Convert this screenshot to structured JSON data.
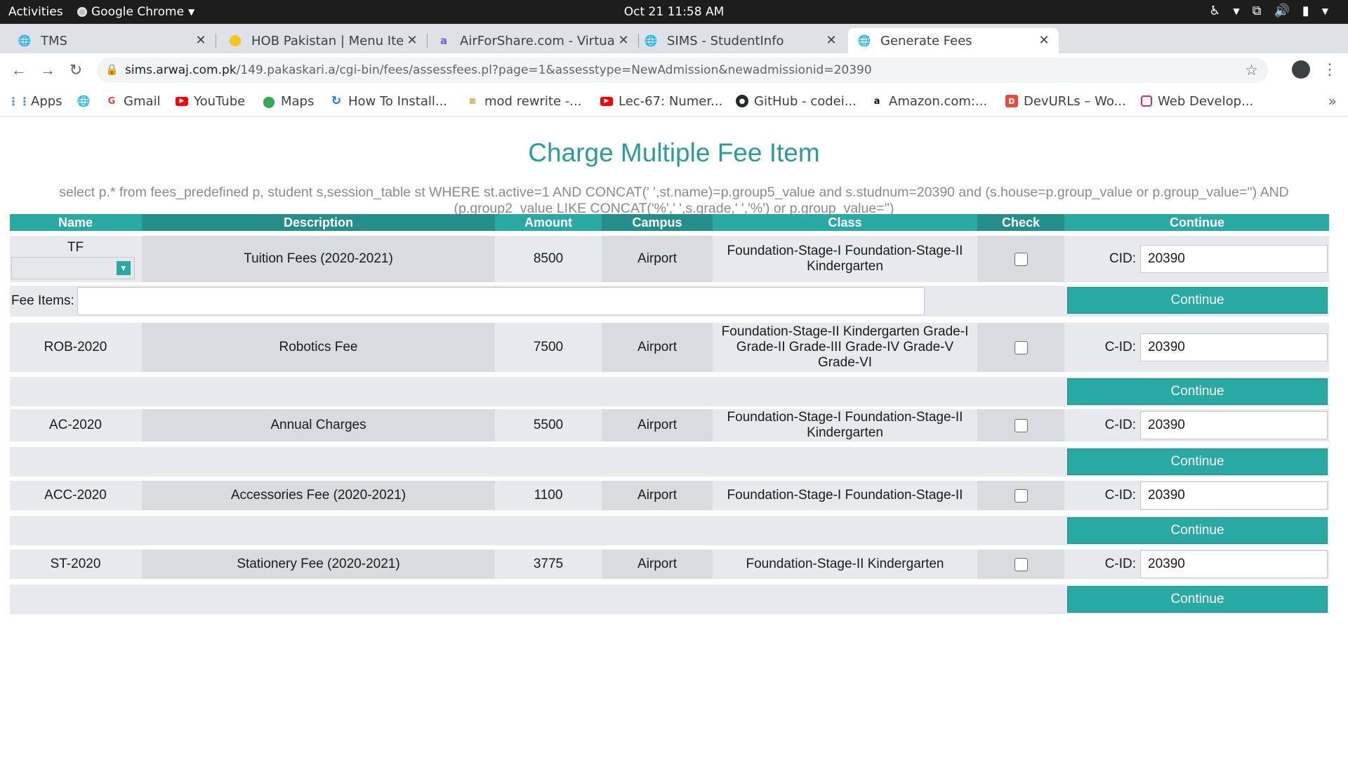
{
  "system": {
    "activities": "Activities",
    "app_name": "Google Chrome",
    "clock": "Oct 21  11:58 AM"
  },
  "tabs": [
    {
      "title": "TMS",
      "icon": "globe-icon",
      "active": false
    },
    {
      "title": "HOB Pakistan | Menu Item",
      "icon": "burger-icon",
      "active": false
    },
    {
      "title": "AirForShare.com - Virtual",
      "icon": "airforshare-icon",
      "active": false
    },
    {
      "title": "SIMS - StudentInfo",
      "icon": "globe-icon",
      "active": false
    },
    {
      "title": "Generate Fees",
      "icon": "globe-icon",
      "active": true
    }
  ],
  "address": {
    "host": "sims.arwaj.com.pk",
    "path": "/149.pakaskari.a/cgi-bin/fees/assessfees.pl?page=1&assesstype=NewAdmission&newadmissionid=20390"
  },
  "bookmarks": [
    {
      "label": "Apps",
      "icon": "apps-grid-icon"
    },
    {
      "label": "",
      "icon": "globe-icon"
    },
    {
      "label": "Gmail",
      "icon": "google-icon"
    },
    {
      "label": "YouTube",
      "icon": "youtube-icon"
    },
    {
      "label": "Maps",
      "icon": "maps-pin-icon"
    },
    {
      "label": "How To Install...",
      "icon": "refresh-blue-icon"
    },
    {
      "label": "mod rewrite -...",
      "icon": "stackoverflow-icon"
    },
    {
      "label": "Lec-67: Numer...",
      "icon": "youtube-icon"
    },
    {
      "label": "GitHub - codei...",
      "icon": "github-icon"
    },
    {
      "label": "Amazon.com:...",
      "icon": "amazon-icon"
    },
    {
      "label": "DevURLs – Wo...",
      "icon": "devurls-icon"
    },
    {
      "label": "Web Develop...",
      "icon": "webdev-icon"
    }
  ],
  "page": {
    "title": "Charge Multiple Fee Item",
    "sql": "select p.* from fees_predefined p, student s,session_table st WHERE st.active=1 AND CONCAT(' ',st.name)=p.group5_value and s.studnum=20390 and (s.house=p.group_value or p.group_value='') AND (p.group2_value LIKE CONCAT('%',' ',s.grade,' ','%') or p.group_value='')"
  },
  "table": {
    "headers": {
      "name": "Name",
      "description": "Description",
      "amount": "Amount",
      "campus": "Campus",
      "class": "Class",
      "check": "Check",
      "continue": "Continue"
    },
    "fee_items_label": "Fee Items:",
    "continue_label": "Continue",
    "rows": [
      {
        "name": "TF",
        "description": "Tuition Fees (2020-2021)",
        "amount": "8500",
        "campus": "Airport",
        "class": "Foundation-Stage-I Foundation-Stage-II Kindergarten",
        "cid_label": "CID:",
        "cid_value": "20390",
        "checked": false
      },
      {
        "name": "ROB-2020",
        "description": "Robotics Fee",
        "amount": "7500",
        "campus": "Airport",
        "class": "Foundation-Stage-II Kindergarten Grade-I Grade-II Grade-III Grade-IV Grade-V Grade-VI",
        "cid_label": "C-ID:",
        "cid_value": "20390",
        "checked": false
      },
      {
        "name": "AC-2020",
        "description": "Annual Charges",
        "amount": "5500",
        "campus": "Airport",
        "class": "Foundation-Stage-I Foundation-Stage-II Kindergarten",
        "cid_label": "C-ID:",
        "cid_value": "20390",
        "checked": false
      },
      {
        "name": "ACC-2020",
        "description": "Accessories Fee (2020-2021)",
        "amount": "1100",
        "campus": "Airport",
        "class": "Foundation-Stage-I Foundation-Stage-II",
        "cid_label": "C-ID:",
        "cid_value": "20390",
        "checked": false
      },
      {
        "name": "ST-2020",
        "description": "Stationery Fee (2020-2021)",
        "amount": "3775",
        "campus": "Airport",
        "class": "Foundation-Stage-II Kindergarten",
        "cid_label": "C-ID:",
        "cid_value": "20390",
        "checked": false
      }
    ]
  },
  "colors": {
    "accent": "#29a9a4",
    "title": "#2a9d98",
    "row_bg": "#e8e9ee",
    "row_alt_bg": "#dadbe0"
  }
}
